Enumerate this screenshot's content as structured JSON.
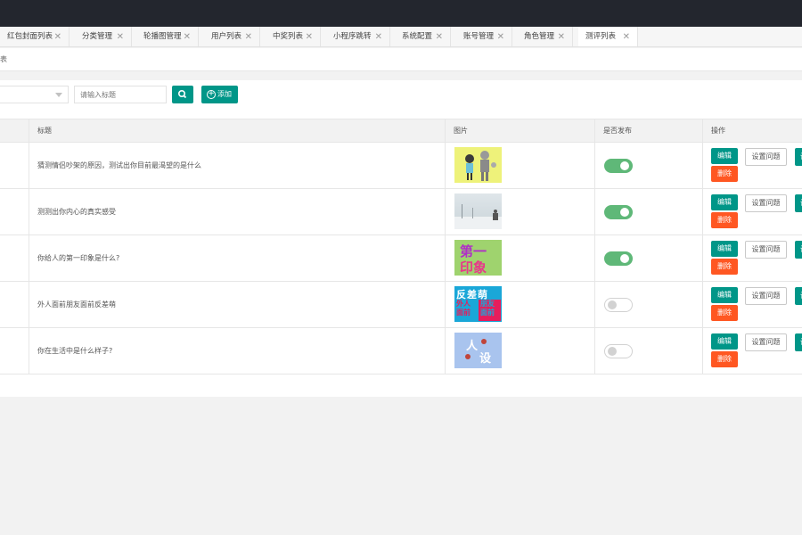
{
  "tabs": [
    {
      "label": "红包封面列表"
    },
    {
      "label": "分类管理"
    },
    {
      "label": "轮播图管理"
    },
    {
      "label": "用户列表"
    },
    {
      "label": "中奖列表"
    },
    {
      "label": "小程序跳转"
    },
    {
      "label": "系统配置"
    },
    {
      "label": "账号管理"
    },
    {
      "label": "角色管理"
    },
    {
      "label": "测评列表",
      "active": true
    }
  ],
  "breadcrumb": "表",
  "toolbar": {
    "search_placeholder": "请输入标题",
    "add_label": "添加"
  },
  "table": {
    "columns": [
      "标题",
      "图片",
      "是否发布",
      "操作"
    ],
    "rows": [
      {
        "title": "猜测情侣吵架的原因，测试出你目前最渴望的是什么",
        "published": true,
        "image": "couple-illustration"
      },
      {
        "title": "测测出你内心的真实感受",
        "published": true,
        "image": "snow-landscape"
      },
      {
        "title": "你给人的第一印象是什么?",
        "published": true,
        "image": "first-impression",
        "image_text": [
          "第一",
          "印象"
        ]
      },
      {
        "title": "外人面前朋友面前反差萌",
        "published": false,
        "image": "contrast-cute",
        "image_text": [
          "反差萌",
          "外人",
          "面前",
          "朋友",
          "面前"
        ]
      },
      {
        "title": "你在生活中是什么样子?",
        "published": false,
        "image": "persona",
        "image_text": [
          "人",
          "设"
        ]
      }
    ],
    "actions": {
      "edit": "编辑",
      "delete": "删除",
      "set_question": "设置问题",
      "extra": "设"
    }
  },
  "colors": {
    "primary": "#009688",
    "danger": "#ff5722",
    "switch_on": "#5fb878",
    "topbar": "#23262e"
  }
}
